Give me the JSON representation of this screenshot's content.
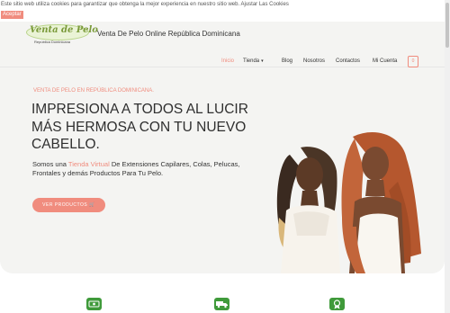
{
  "cookie": {
    "message": "Este sitio web utiliza cookies para garantizar que obtenga la mejor experiencia en nuestro sitio web. Ajustar Las Cookies",
    "accept_label": "Aceptar"
  },
  "header": {
    "logo_text": "Venta de Pelo",
    "logo_subtext": "República Dominicana",
    "site_title": "Venta De Pelo Online República Dominicana"
  },
  "nav": {
    "items": [
      {
        "label": "Inicio",
        "active": true
      },
      {
        "label": "Tienda",
        "has_dropdown": true
      },
      {
        "label": "Blog"
      },
      {
        "label": "Nosotros"
      },
      {
        "label": "Contactos"
      },
      {
        "label": "Mi Cuenta"
      }
    ],
    "cart_count": "0"
  },
  "hero": {
    "eyebrow": "VENTA DE PELO EN REPÚBLICA DOMINICANA.",
    "headline": "IMPRESIONA A TODOS AL LUCIR MÁS HERMOSA CON TU NUEVO CABELLO.",
    "subtext_before": "Somos una",
    "subtext_highlight": "Tienda Virtual",
    "subtext_after": "De Extensiones Capilares, Colas, Pelucas, Frontales y demás Productos Para Tu Pelo.",
    "cta_label": "VER PRODUCTOS 🛒"
  },
  "features": {
    "icons": [
      "money-icon",
      "delivery-truck-icon",
      "award-icon"
    ]
  },
  "colors": {
    "accent": "#f08c7e",
    "feature_green": "#3f9a3a",
    "logo_green": "#7a9a3a"
  }
}
